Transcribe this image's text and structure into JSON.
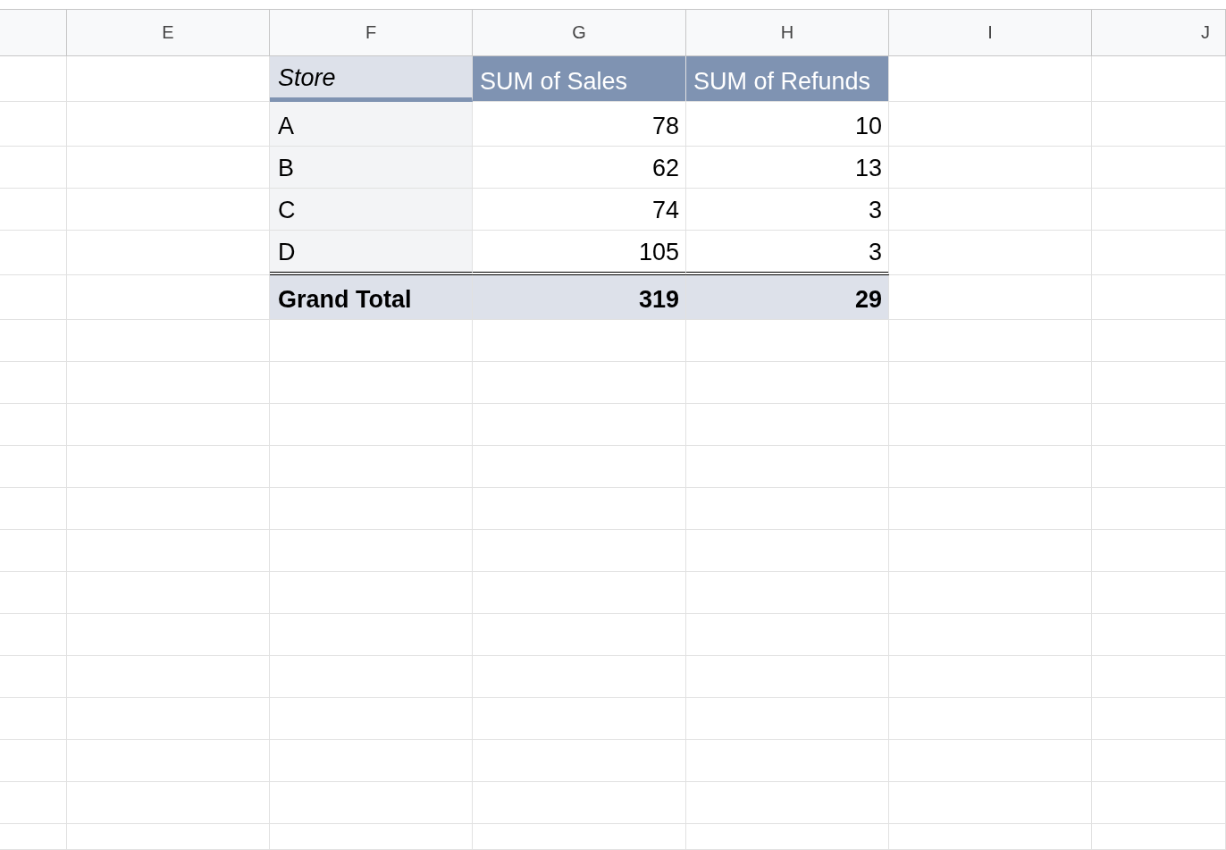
{
  "column_headers": [
    "E",
    "F",
    "G",
    "H",
    "I",
    "J"
  ],
  "pivot_table": {
    "columns": [
      "Store",
      "SUM of Sales",
      "SUM of Refunds"
    ],
    "rows": [
      {
        "store": "A",
        "sales": "78",
        "refunds": "10"
      },
      {
        "store": "B",
        "sales": "62",
        "refunds": "13"
      },
      {
        "store": "C",
        "sales": "74",
        "refunds": "3"
      },
      {
        "store": "D",
        "sales": "105",
        "refunds": "3"
      }
    ],
    "grand_total": {
      "label": "Grand Total",
      "sales": "319",
      "refunds": "29"
    }
  }
}
